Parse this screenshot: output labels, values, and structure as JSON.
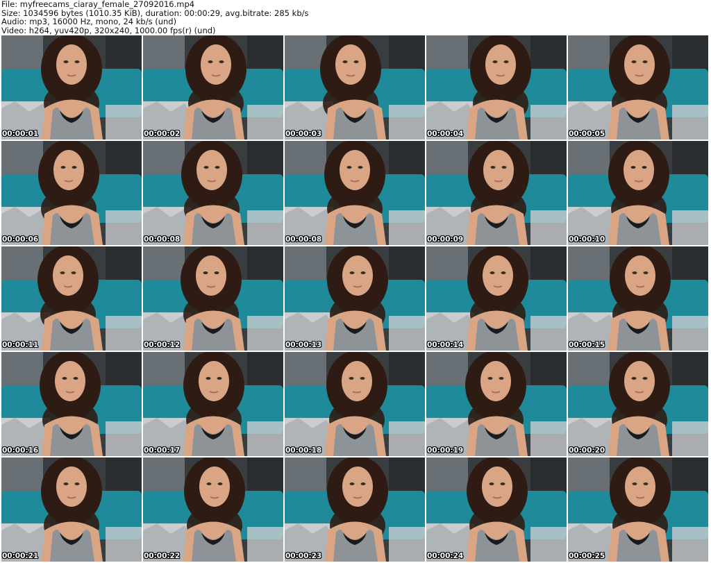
{
  "header": {
    "file_line": "File: myfreecams_ciaray_female_27092016.mp4",
    "size_line": "Size: 1034596 bytes (1010.35 KiB), duration: 00:00:29, avg.bitrate: 285 kb/s",
    "audio_line": "Audio: mp3, 16000 Hz, mono, 24 kb/s (und)",
    "video_line": "Video: h264, yuv420p, 320x240, 1000.00 fps(r) (und)"
  },
  "thumbnails": [
    {
      "timestamp": "00:00:01"
    },
    {
      "timestamp": "00:00:02"
    },
    {
      "timestamp": "00:00:03"
    },
    {
      "timestamp": "00:00:04"
    },
    {
      "timestamp": "00:00:05"
    },
    {
      "timestamp": "00:00:06"
    },
    {
      "timestamp": "00:00:08"
    },
    {
      "timestamp": "00:00:08"
    },
    {
      "timestamp": "00:00:09"
    },
    {
      "timestamp": "00:00:10"
    },
    {
      "timestamp": "00:00:11"
    },
    {
      "timestamp": "00:00:12"
    },
    {
      "timestamp": "00:00:13"
    },
    {
      "timestamp": "00:00:14"
    },
    {
      "timestamp": "00:00:15"
    },
    {
      "timestamp": "00:00:16"
    },
    {
      "timestamp": "00:00:17"
    },
    {
      "timestamp": "00:00:18"
    },
    {
      "timestamp": "00:00:19"
    },
    {
      "timestamp": "00:00:20"
    },
    {
      "timestamp": "00:00:21"
    },
    {
      "timestamp": "00:00:22"
    },
    {
      "timestamp": "00:00:23"
    },
    {
      "timestamp": "00:00:24"
    },
    {
      "timestamp": "00:00:25"
    }
  ],
  "colors": {
    "background_wall": "#3a3d40",
    "headboard": "#1f8a9a",
    "pillow": "#c9cdd0",
    "skin": "#d9a585",
    "hair": "#2e1c14",
    "top": "#8d9396",
    "bra": "#1a1a1d"
  }
}
